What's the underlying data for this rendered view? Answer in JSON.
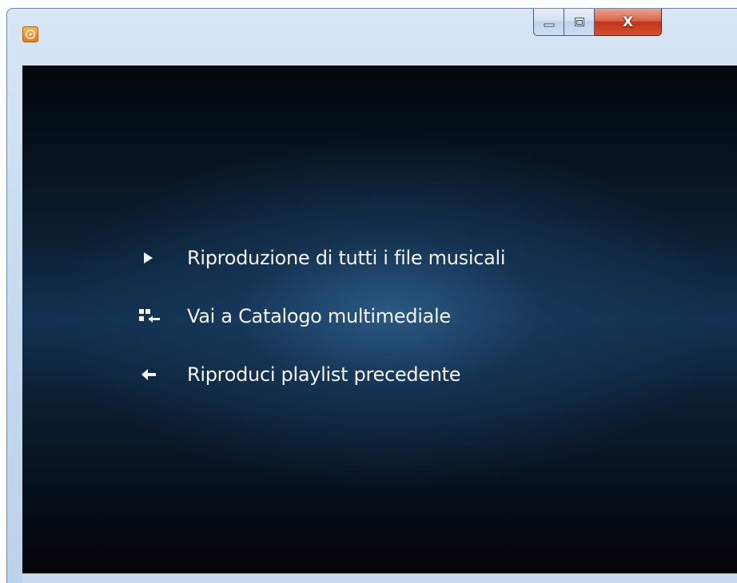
{
  "window": {
    "title": "",
    "app_icon": "media-player-icon",
    "controls": {
      "minimize_icon": "minimize-icon",
      "maximize_icon": "maximize-icon",
      "close_label": "X"
    }
  },
  "menu": {
    "items": [
      {
        "icon": "play-icon",
        "label": "Riproduzione di tutti i file musicali"
      },
      {
        "icon": "library-icon",
        "label": "Vai a Catalogo multimediale"
      },
      {
        "icon": "back-arrow-icon",
        "label": "Riproduci playlist precedente"
      }
    ]
  },
  "colors": {
    "accent_orange": "#f07a12",
    "close_red": "#c3361b",
    "background_dark": "#0a1a2b",
    "text_light": "#f2f4f6"
  }
}
